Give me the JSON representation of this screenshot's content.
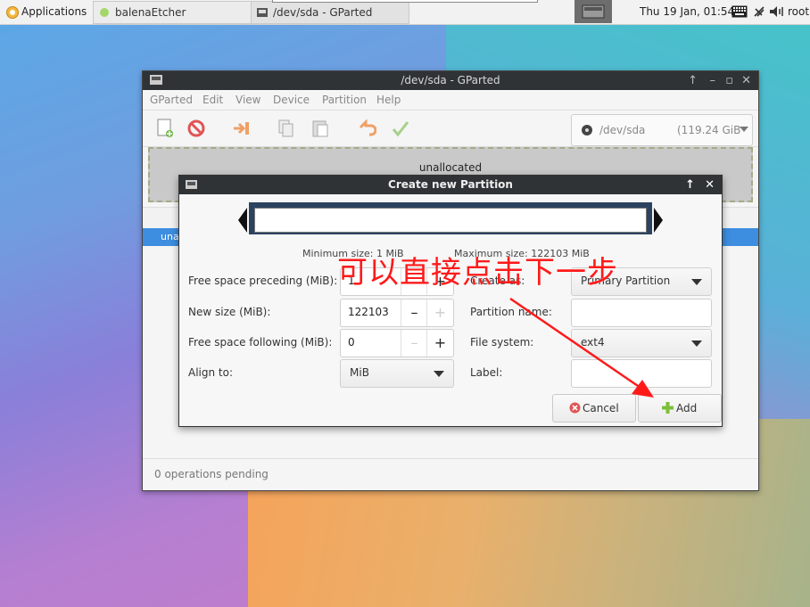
{
  "panel": {
    "applications": "Applications",
    "tasks": [
      {
        "label": "balenaEtcher"
      },
      {
        "label": "/dev/sda - GParted"
      }
    ],
    "clock": "Thu 19 Jan, 01:54",
    "user": "root"
  },
  "window": {
    "title": "/dev/sda - GParted",
    "menu": [
      "GParted",
      "Edit",
      "View",
      "Device",
      "Partition",
      "Help"
    ],
    "device": "/dev/sda",
    "device_size": "(119.24 GiB",
    "graph_label": "unallocated",
    "list_row": "una",
    "status": "0 operations pending"
  },
  "dialog": {
    "title": "Create new Partition",
    "min_size": "Minimum size: 1 MiB",
    "max_size": "Maximum size: 122103 MiB",
    "labels": {
      "free_preceding": "Free space preceding (MiB):",
      "new_size": "New size (MiB):",
      "free_following": "Free space following (MiB):",
      "align": "Align to:",
      "create_as": "Create as:",
      "partition_name": "Partition name:",
      "file_system": "File system:",
      "label": "Label:"
    },
    "values": {
      "free_preceding": "1",
      "new_size": "122103",
      "free_following": "0",
      "align": "MiB",
      "create_as": "Primary Partition",
      "file_system": "ext4",
      "partition_name": "",
      "label": ""
    },
    "buttons": {
      "cancel": "Cancel",
      "add": "Add"
    }
  },
  "annotation": "可以直接点击下一步",
  "colors": {
    "accent": "#3d8ee0",
    "annotation": "#ff1a1a",
    "titlebar": "#2f3336"
  }
}
